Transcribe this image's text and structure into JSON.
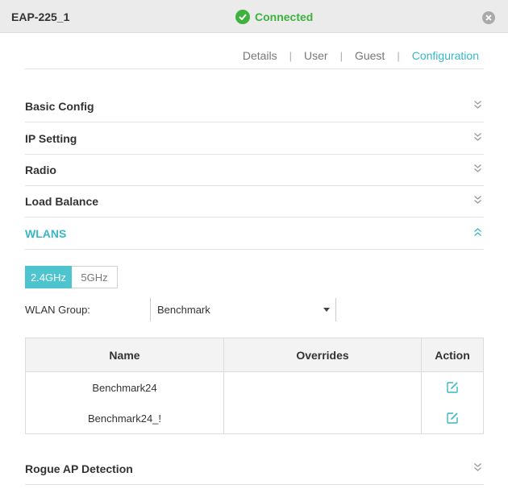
{
  "window": {
    "title": "EAP-225_1",
    "status": {
      "label": "Connected",
      "color": "#3db23d",
      "icon": "check-circle-icon"
    },
    "close_icon": "close-icon"
  },
  "tabs": [
    {
      "label": "Details",
      "active": false
    },
    {
      "label": "User",
      "active": false
    },
    {
      "label": "Guest",
      "active": false
    },
    {
      "label": "Configuration",
      "active": true
    }
  ],
  "accent_color": "#37b7c8",
  "sections": [
    {
      "label": "Basic Config",
      "expanded": false
    },
    {
      "label": "IP Setting",
      "expanded": false
    },
    {
      "label": "Radio",
      "expanded": false
    },
    {
      "label": "Load Balance",
      "expanded": false
    },
    {
      "label": "WLANS",
      "expanded": true
    }
  ],
  "wlans": {
    "bands": [
      {
        "label": "2.4GHz",
        "selected": true
      },
      {
        "label": "5GHz",
        "selected": false
      }
    ],
    "group_label": "WLAN Group:",
    "group_value": "Benchmark",
    "table": {
      "headers": {
        "name": "Name",
        "overrides": "Overrides",
        "action": "Action"
      },
      "rows": [
        {
          "name": "Benchmark24",
          "overrides": "",
          "action_icon": "edit-icon"
        },
        {
          "name": "Benchmark24_!",
          "overrides": "",
          "action_icon": "edit-icon"
        }
      ]
    }
  },
  "footer_section": {
    "label": "Rogue AP Detection",
    "expanded": false
  }
}
